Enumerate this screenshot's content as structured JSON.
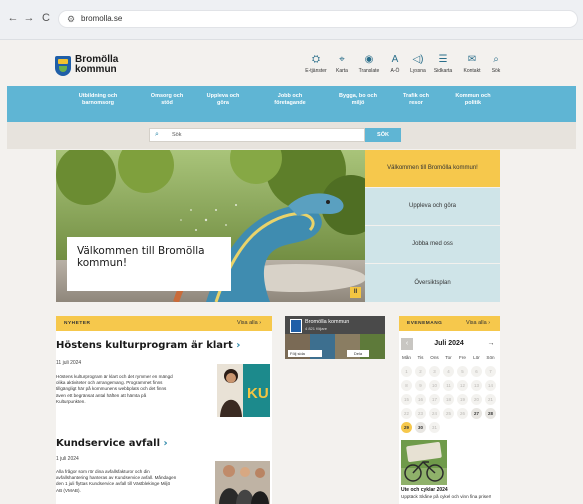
{
  "browser": {
    "url": "bromolla.se",
    "back_icon": "←",
    "forward_icon": "→",
    "reload_icon": "C",
    "site_icon": "⚙"
  },
  "header": {
    "logo_line1": "Bromölla",
    "logo_line2": "kommun",
    "tools": [
      {
        "label": "E-tjänster",
        "icon": "⛭"
      },
      {
        "label": "Karta",
        "icon": "⌖"
      },
      {
        "label": "Translate",
        "icon": "◉"
      },
      {
        "label": "A-Ö",
        "icon": "A"
      },
      {
        "label": "Lyssna",
        "icon": "◁)"
      },
      {
        "label": "Sidkarta",
        "icon": "☰"
      },
      {
        "label": "Kontakt",
        "icon": "✉"
      },
      {
        "label": "Sök",
        "icon": "⌕"
      }
    ]
  },
  "nav": {
    "items": [
      {
        "line1": "Utbildning och",
        "line2": "barnomsorg"
      },
      {
        "line1": "Omsorg och",
        "line2": "stöd"
      },
      {
        "line1": "Uppleva och",
        "line2": "göra"
      },
      {
        "line1": "Jobb och",
        "line2": "företagande"
      },
      {
        "line1": "Bygga, bo och",
        "line2": "miljö"
      },
      {
        "line1": "Trafik och",
        "line2": "resor"
      },
      {
        "line1": "Kommun och",
        "line2": "politik"
      }
    ]
  },
  "search": {
    "placeholder": "Sök",
    "button": "SÖK"
  },
  "hero": {
    "caption_line1": "Välkommen till Bromölla",
    "caption_line2": "kommun!",
    "pause": "II"
  },
  "quicklinks": [
    "Välkommen till Bromölla kommun!",
    "Uppleva och göra",
    "Jobba med oss",
    "Översiktsplan"
  ],
  "news": {
    "heading": "NYHETER",
    "view_all": "Visa alla ›",
    "items": [
      {
        "title": "Höstens kulturprogram är klart",
        "chevron": "›",
        "date": "11 juli 2024",
        "body": [
          "Höstens kulturprogram är klart och det rymmer en mängd",
          "olika aktiviteter och arrangemang. Programmet finns",
          "tillgängligt här på kommunens webbplats och det finns",
          "även ett begränsat antal häften att hämta på",
          "Kulturpunkten."
        ],
        "thumb_text": "KU"
      },
      {
        "title": "Kundservice avfall",
        "chevron": "›",
        "date": "1 juli 2024",
        "body": [
          "Alla frågor som rör dina avfallsfakturor och din",
          "avfallshantering hanteras av Kundservice avfall. Måndagen",
          "den 1 juli flyttas Kundservice avfall till Västblekinge Miljö",
          "AB (VMAB)."
        ]
      }
    ]
  },
  "facebook": {
    "name": "Bromölla kommun",
    "likes": "4 821 följare",
    "follow": "Följ sida",
    "share": "Dela"
  },
  "events": {
    "heading": "EVENEMANG",
    "view_all": "Visa alla ›",
    "month": "Juli 2024",
    "prev": "‹",
    "next": "→",
    "weekdays": [
      "Mån",
      "Tis",
      "Ons",
      "Tor",
      "Fre",
      "Lör",
      "Sön"
    ],
    "weeks": [
      [
        "1",
        "2",
        "3",
        "4",
        "5",
        "6",
        "7"
      ],
      [
        "8",
        "9",
        "10",
        "11",
        "12",
        "13",
        "14"
      ],
      [
        "15",
        "16",
        "17",
        "18",
        "19",
        "20",
        "21"
      ],
      [
        "22",
        "23",
        "24",
        "25",
        "26",
        "27",
        "28"
      ],
      [
        "29",
        "30",
        "31",
        "",
        "",
        "",
        ""
      ]
    ],
    "active_days": [
      "27",
      "28",
      "30"
    ],
    "today": "29",
    "event_title": "Ute och cyklar 2024",
    "event_desc": "Upptäck Skåne på cykel och vinn fina priser!"
  }
}
